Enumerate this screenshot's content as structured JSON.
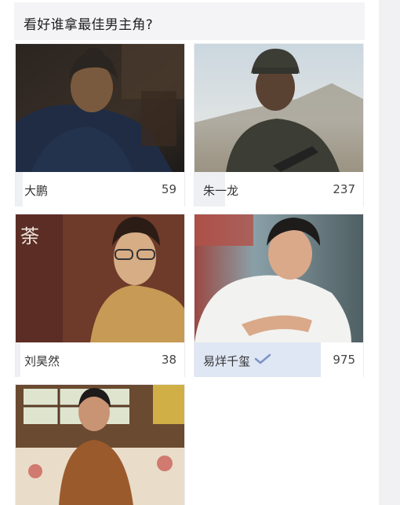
{
  "question": "看好谁拿最佳男主角?",
  "options": [
    {
      "name": "大鹏",
      "votes": "59",
      "share": 0.04,
      "selected": false
    },
    {
      "name": "朱一龙",
      "votes": "237",
      "share": 0.18,
      "selected": false
    },
    {
      "name": "刘昊然",
      "votes": "38",
      "share": 0.03,
      "selected": false
    },
    {
      "name": "易烊千玺",
      "votes": "975",
      "share": 0.75,
      "selected": true
    },
    {
      "name": "",
      "votes": "",
      "share": 0,
      "selected": false
    }
  ],
  "photo_overlay_text": [
    "荼"
  ],
  "colors": {
    "selected_fill": "#dfe6f4",
    "check_mark": "#7b93c6",
    "question_bg": "#f4f4f6"
  }
}
